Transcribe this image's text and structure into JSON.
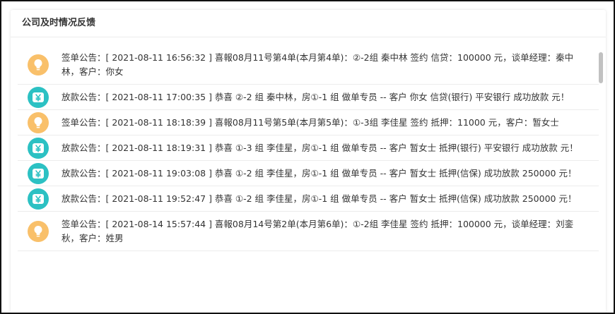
{
  "panel": {
    "title": "公司及时情况反馈"
  },
  "feed": [
    {
      "type": "bulb",
      "icon": "lightbulb-icon",
      "text": "签单公告：[ 2021-08-11 16:56:32 ] 喜報08月11号第4单(本月第4单)：②-2组 秦中林 签约 信贷：100000 元，谈单经理：秦中林，客户：你女"
    },
    {
      "type": "money",
      "icon": "yen-icon",
      "text": "放款公告：[ 2021-08-11 17:00:35 ] 恭喜 ②-2 组 秦中林，房①-1 组 做单专员 -- 客户 你女 信贷(银行) 平安银行 成功放款 元！"
    },
    {
      "type": "bulb",
      "icon": "lightbulb-icon",
      "text": "签单公告：[ 2021-08-11 18:18:39 ] 喜報08月11号第5单(本月第5单)：①-3组 李佳星 签约 抵押：11000 元，客户：暂女士"
    },
    {
      "type": "money",
      "icon": "yen-icon",
      "text": "放款公告：[ 2021-08-11 18:19:31 ] 恭喜 ①-3 组 李佳星，房①-1 组 做单专员 -- 客户 暂女士 抵押(银行) 平安银行 成功放款 元！"
    },
    {
      "type": "money",
      "icon": "yen-icon",
      "text": "放款公告：[ 2021-08-11 19:03:08 ] 恭喜 ①-2 组 李佳星，房①-1 组 做单专员 -- 客户 暂女士 抵押(信保) 成功放款 250000 元！"
    },
    {
      "type": "money",
      "icon": "yen-icon",
      "text": "放款公告：[ 2021-08-11 19:52:47 ] 恭喜 ①-2 组 李佳星，房①-1 组 做单专员 -- 客户 暂女士 抵押(信保) 成功放款 250000 元！"
    },
    {
      "type": "bulb",
      "icon": "lightbulb-icon",
      "text": "签单公告：[ 2021-08-14 15:57:44 ] 喜報08月14号第2单(本月第6单)：①-2组 李佳星 签约 抵押：100000 元，谈单经理：刘銮秋，客户：姓男"
    }
  ],
  "colors": {
    "bulb": "#f9c06a",
    "money": "#2cc1c3",
    "text": "#333333"
  }
}
